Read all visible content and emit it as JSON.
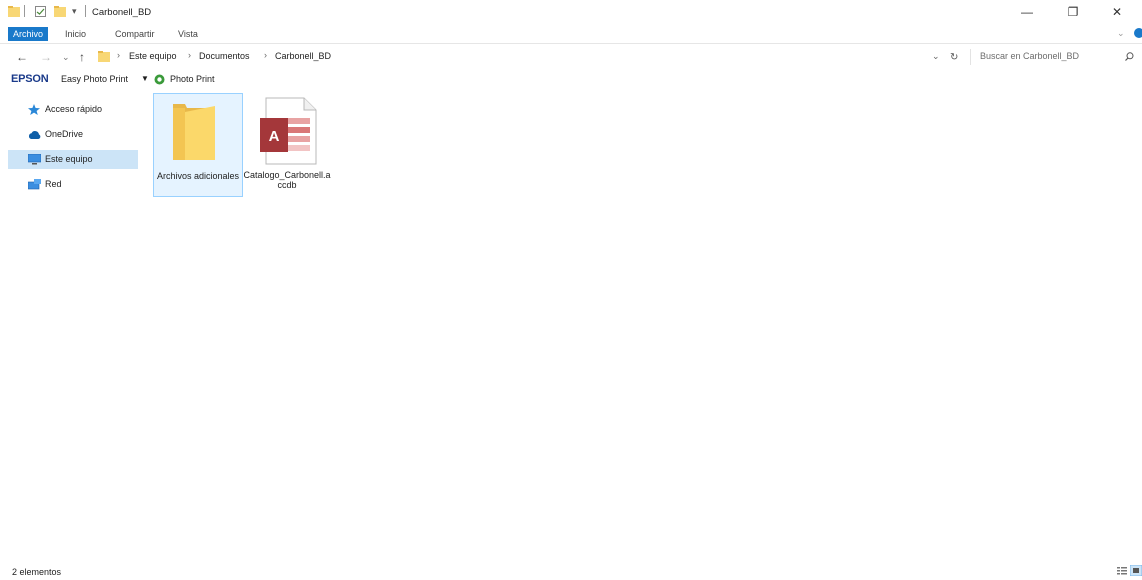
{
  "window": {
    "title": "Carbonell_BD",
    "controls": {
      "minimize": "—",
      "restore": "❐",
      "close": "✕"
    }
  },
  "ribbon": {
    "tabs": [
      "Archivo",
      "Inicio",
      "Compartir",
      "Vista"
    ]
  },
  "address": {
    "breadcrumb": [
      "Este equipo",
      "Documentos",
      "Carbonell_BD"
    ],
    "search_placeholder": "Buscar en Carbonell_BD"
  },
  "epson": {
    "logo": "EPSON",
    "easy_photo_print": "Easy Photo Print",
    "photo_print": "Photo Print"
  },
  "sidebar": {
    "items": [
      {
        "label": "Acceso rápido",
        "icon": "star-icon"
      },
      {
        "label": "OneDrive",
        "icon": "cloud-icon"
      },
      {
        "label": "Este equipo",
        "icon": "computer-icon",
        "selected": true
      },
      {
        "label": "Red",
        "icon": "network-icon"
      }
    ]
  },
  "files": [
    {
      "name": "Archivos adicionales",
      "type": "folder",
      "selected": true
    },
    {
      "name": "Catalogo_Carbonell.accdb",
      "type": "access-database"
    }
  ],
  "status": {
    "count": "2 elementos"
  },
  "colors": {
    "accent": "#1979ca",
    "selection": "#cce4f7",
    "folder": "#f8d775"
  }
}
